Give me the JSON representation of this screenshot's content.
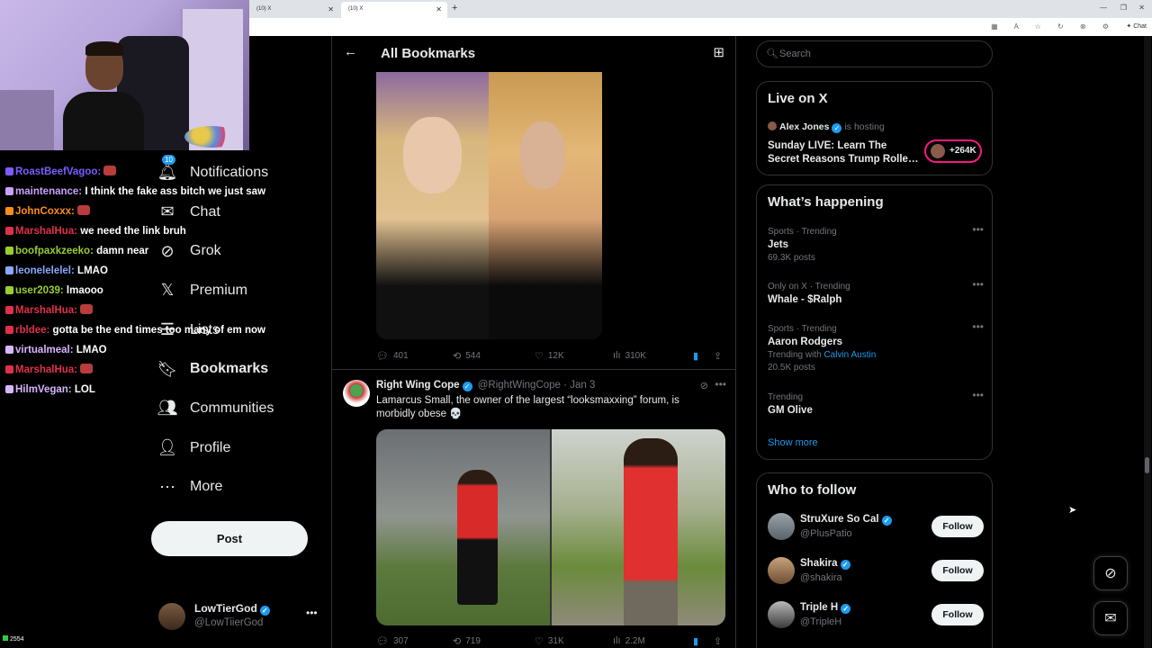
{
  "browser": {
    "tabs": [
      {
        "label": "(10) X"
      },
      {
        "label": "(10) X"
      }
    ],
    "new_tab_icon": "+",
    "copilot_label": "Chat"
  },
  "stream": {
    "viewer_count": "2554",
    "chat": [
      {
        "user": "RoastBeefVagoo:",
        "user_color": "#7d5cff",
        "msg": ""
      },
      {
        "user": "maintenance:",
        "user_color": "#c8a2ff",
        "msg": "I think the fake ass bitch we just saw"
      },
      {
        "user": "JohnCoxxx:",
        "user_color": "#ff8c1a",
        "msg": ""
      },
      {
        "user": "MarshalHua:",
        "user_color": "#e0304b",
        "msg": "we need the link bruh"
      },
      {
        "user": "boofpaxkzeeko:",
        "user_color": "#9acd32",
        "msg": "damn near"
      },
      {
        "user": "leonelelelel:",
        "user_color": "#8aa8ff",
        "msg": "LMAO"
      },
      {
        "user": "user2039:",
        "user_color": "#9acd32",
        "msg": "lmaooo"
      },
      {
        "user": "MarshalHua:",
        "user_color": "#e0304b",
        "msg": ""
      },
      {
        "user": "rbldee:",
        "user_color": "#e0304b",
        "msg": "gotta be the end times too many of em now"
      },
      {
        "user": "virtualmeal:",
        "user_color": "#d7b6ff",
        "msg": "LMAO"
      },
      {
        "user": "MarshalHua:",
        "user_color": "#e0304b",
        "msg": ""
      },
      {
        "user": "HilmVegan:",
        "user_color": "#d7b6ff",
        "msg": "LOL"
      }
    ]
  },
  "nav": {
    "notif_count": "10",
    "items": [
      {
        "label": "Notifications",
        "icon": "bell"
      },
      {
        "label": "Chat",
        "icon": "envelope"
      },
      {
        "label": "Grok",
        "icon": "grok"
      },
      {
        "label": "Premium",
        "icon": "x-logo"
      },
      {
        "label": "Lists",
        "icon": "list"
      },
      {
        "label": "Bookmarks",
        "icon": "bookmark"
      },
      {
        "label": "Communities",
        "icon": "people"
      },
      {
        "label": "Profile",
        "icon": "person"
      },
      {
        "label": "More",
        "icon": "more-circle"
      }
    ],
    "post_label": "Post",
    "account": {
      "name": "LowTierGod",
      "handle": "@LowTiierGod"
    }
  },
  "main": {
    "title": "All Bookmarks",
    "tweet1": {
      "replies": "401",
      "retweets": "544",
      "likes": "12K",
      "views": "310K"
    },
    "tweet2": {
      "name": "Right Wing Cope",
      "handle": "@RightWingCope",
      "sep": "·",
      "date": "Jan 3",
      "text": "Lamarcus Small, the owner of the largest “looksmaxxing” forum, is morbidly obese 💀",
      "replies": "307",
      "retweets": "719",
      "likes": "31K",
      "views": "2.2M"
    }
  },
  "sidebar": {
    "search_placeholder": "Search",
    "live": {
      "title": "Live on X",
      "host": "Alex Jones",
      "host_suffix": "is hosting",
      "stream_title": "Sunday LIVE: Learn The Secret Reasons Trump Rolle…",
      "listeners": "+264K"
    },
    "happening": {
      "title": "What’s happening",
      "trends": [
        {
          "category": "Sports · Trending",
          "name": "Jets",
          "sub": "69.3K posts",
          "link": ""
        },
        {
          "category": "Only on X · Trending",
          "name": "Whale - $Ralph",
          "sub": "",
          "link": ""
        },
        {
          "category": "Sports · Trending",
          "name": "Aaron Rodgers",
          "sub": "Trending with",
          "link": "Calvin Austin",
          "sub2": "20.5K posts"
        },
        {
          "category": "Trending",
          "name": "GM Olive",
          "sub": "",
          "link": ""
        }
      ],
      "show_more": "Show more"
    },
    "who_to_follow": {
      "title": "Who to follow",
      "follow_label": "Follow",
      "accounts": [
        {
          "name": "StruXure So Cal",
          "handle": "@PlusPatio"
        },
        {
          "name": "Shakira",
          "handle": "@shakira"
        },
        {
          "name": "Triple H",
          "handle": "@TripleH"
        }
      ]
    }
  }
}
